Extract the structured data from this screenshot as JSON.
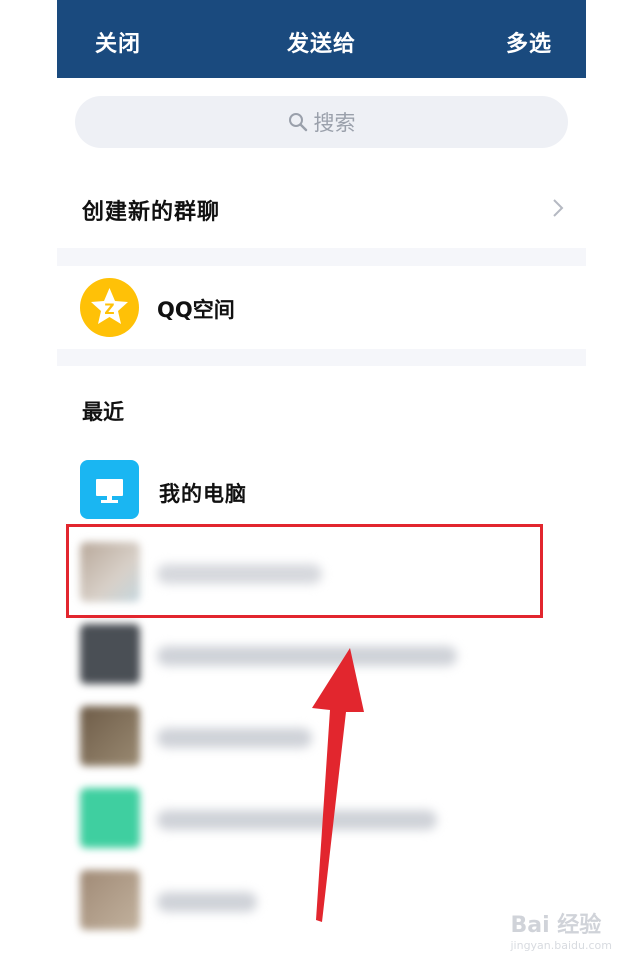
{
  "topbar": {
    "close": "关闭",
    "title": "发送给",
    "multi_select": "多选"
  },
  "search": {
    "placeholder": "搜索"
  },
  "create_group": {
    "label": "创建新的群聊",
    "icon": "chevron-right-icon"
  },
  "qzone": {
    "label": "QQ空间",
    "icon": "qzone-star-icon",
    "color": "#ffc107"
  },
  "recent": {
    "title": "最近",
    "items": [
      {
        "label": "我的电脑",
        "icon": "computer-icon",
        "color": "#1ab6f2"
      },
      {
        "label": "",
        "blurred": true,
        "highlighted": true
      },
      {
        "label": "",
        "blurred": true
      },
      {
        "label": "",
        "blurred": true
      },
      {
        "label": "",
        "blurred": true
      },
      {
        "label": "",
        "blurred": true
      }
    ]
  },
  "annotation": {
    "highlight_color": "#e2262e"
  },
  "watermark": {
    "text": "Bai 经验",
    "sub": "jingyan.baidu.com"
  }
}
